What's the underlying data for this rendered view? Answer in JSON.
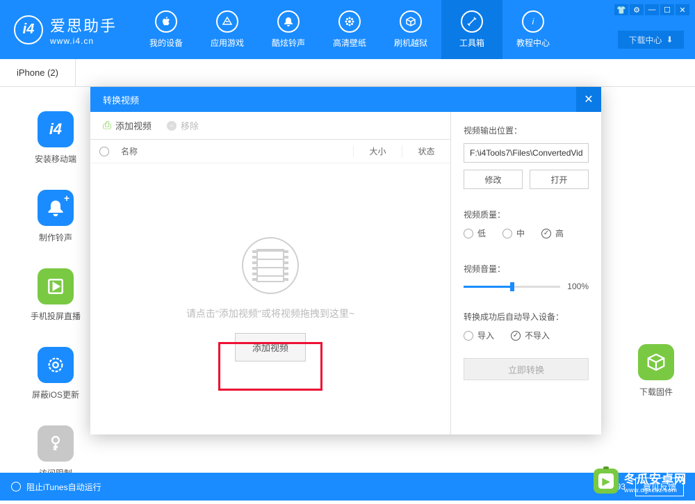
{
  "logo": {
    "name": "爱思助手",
    "url": "www.i4.cn",
    "badge": "i4"
  },
  "nav": [
    {
      "label": "我的设备"
    },
    {
      "label": "应用游戏"
    },
    {
      "label": "酷炫铃声"
    },
    {
      "label": "高清壁纸"
    },
    {
      "label": "刷机越狱"
    },
    {
      "label": "工具箱"
    },
    {
      "label": "教程中心"
    }
  ],
  "download_center": "下载中心",
  "tab": "iPhone (2)",
  "tools": [
    {
      "label": "安装移动端",
      "color": "#1a8cff"
    },
    {
      "label": "制作铃声",
      "color": "#1a8cff"
    },
    {
      "label": "手机投屏直播",
      "color": "#7ac943"
    },
    {
      "label": "屏蔽iOS更新",
      "color": "#1a8cff"
    },
    {
      "label": "访问限制",
      "color": "#c0c0c0"
    }
  ],
  "tool_right": {
    "label": "下载固件",
    "color": "#7ac943"
  },
  "modal": {
    "title": "转换视频",
    "toolbar": {
      "add": "添加视频",
      "remove": "移除"
    },
    "table": {
      "name": "名称",
      "size": "大小",
      "status": "状态"
    },
    "dropzone": {
      "hint": "请点击\"添加视频\"或将视频拖拽到这里~",
      "button": "添加视频"
    },
    "output": {
      "label": "视频输出位置：",
      "path": "F:\\i4Tools7\\Files\\ConvertedVid",
      "modify": "修改",
      "open": "打开"
    },
    "quality": {
      "label": "视频质量：",
      "low": "低",
      "mid": "中",
      "high": "高"
    },
    "volume": {
      "label": "视频音量：",
      "value": "100%"
    },
    "autoimport": {
      "label": "转换成功后自动导入设备：",
      "yes": "导入",
      "no": "不导入"
    },
    "convert": "立即转换"
  },
  "statusbar": {
    "itunes": "阻止iTunes自动运行",
    "version": "V7.93",
    "feedback": "意见反馈"
  },
  "watermark": {
    "title": "冬瓜安卓网",
    "url": "www.dgxcdz.com"
  }
}
